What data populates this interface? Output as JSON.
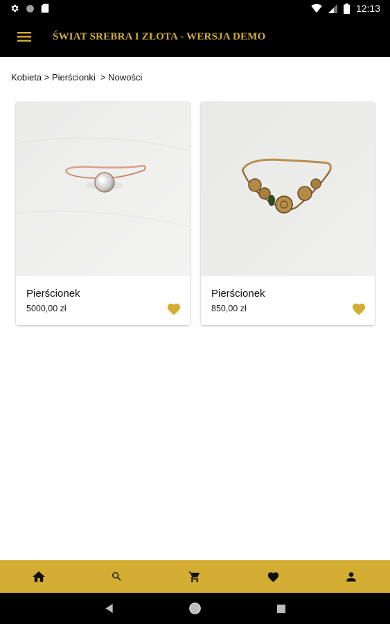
{
  "status_bar": {
    "time": "12:13"
  },
  "app_bar": {
    "title": "ŚWIAT SREBRA I ZŁOTA - WERSJA DEMO"
  },
  "breadcrumb": {
    "items": [
      "Kobieta",
      " > ",
      "Pierścionki",
      "  > ",
      "Nowości"
    ]
  },
  "products": [
    {
      "name": "Pierścionek",
      "price": "5000,00 zł"
    },
    {
      "name": "Pierścionek",
      "price": "850,00 zł"
    }
  ],
  "colors": {
    "accent": "#d4ae33",
    "bar": "#000000"
  },
  "bottom_nav": {
    "icons": [
      "home-icon",
      "search-icon",
      "cart-icon",
      "favorites-icon",
      "account-icon"
    ]
  }
}
